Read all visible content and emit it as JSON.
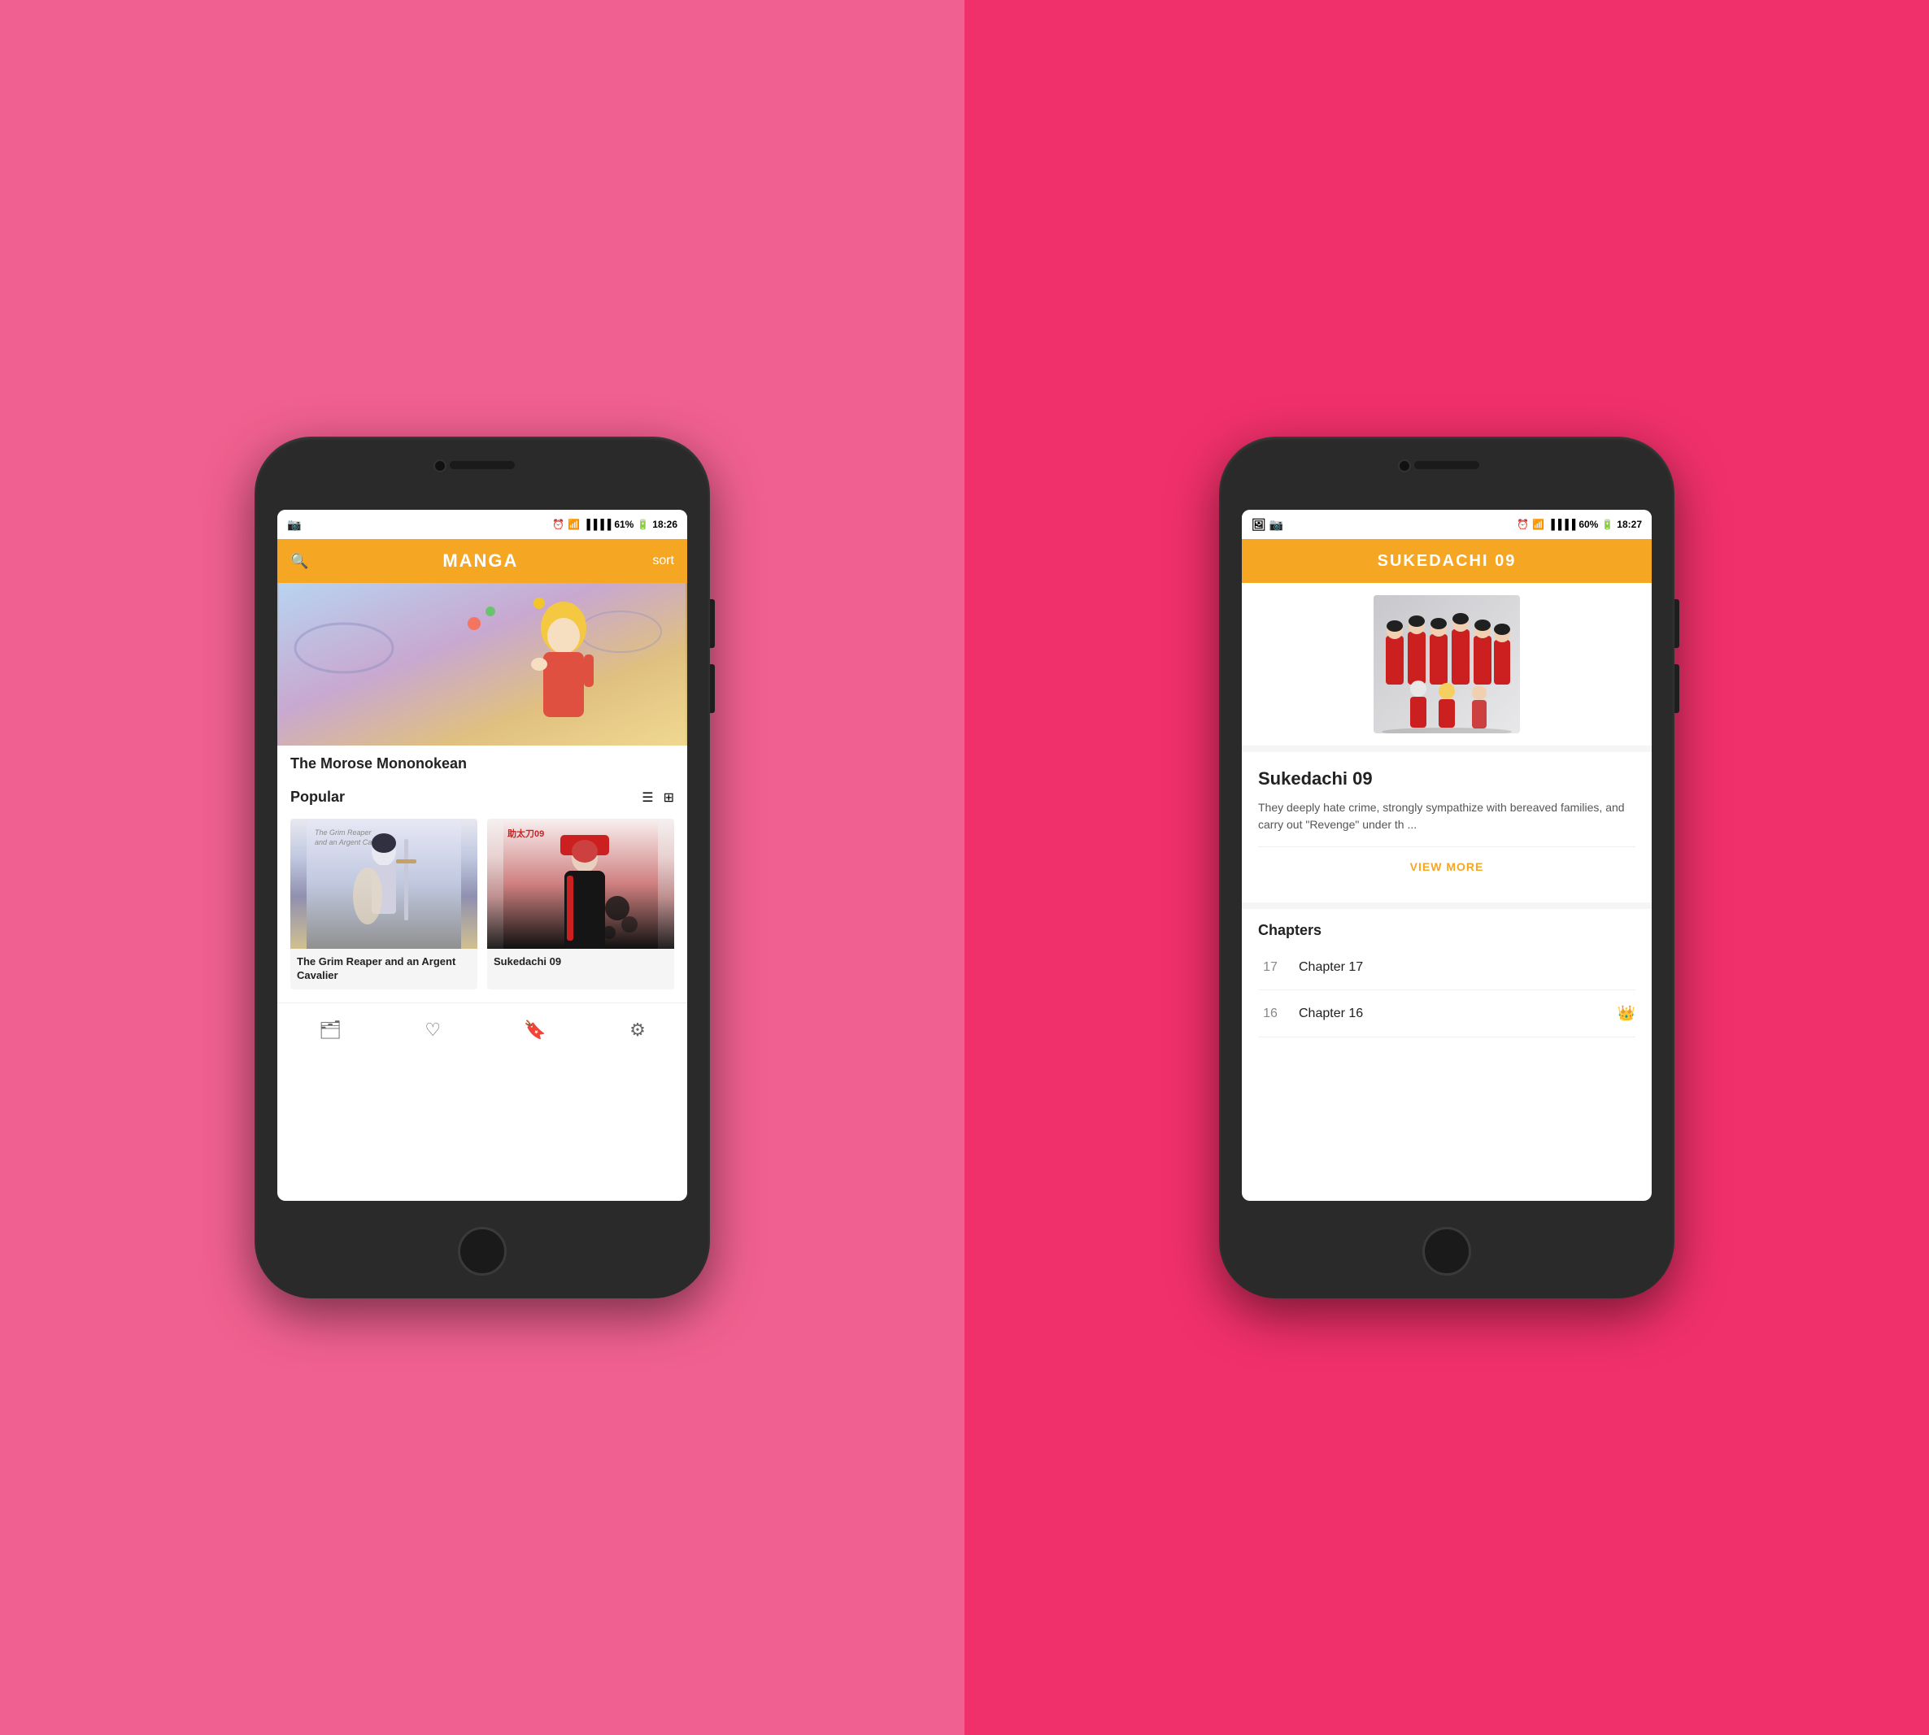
{
  "background": {
    "left_color": "#f06090",
    "right_color": "#f0306a"
  },
  "phone_left": {
    "status_bar": {
      "left_icons": [
        "camera-icon",
        "instagram-icon"
      ],
      "time": "18:26",
      "battery": "61%",
      "signal": "●●●●"
    },
    "header": {
      "title": "MANGA",
      "sort_label": "sort",
      "search_icon": "🔍"
    },
    "featured": {
      "title": "The Morose Mononokean"
    },
    "popular_section": {
      "label": "Popular"
    },
    "manga_cards": [
      {
        "title": "The Grim Reaper and an Argent Cavalier",
        "cover_type": "grim-reaper"
      },
      {
        "title": "Sukedachi 09",
        "cover_type": "sukedachi"
      }
    ],
    "bottom_nav": [
      {
        "icon": "🗂",
        "label": "library"
      },
      {
        "icon": "♡",
        "label": "favorites"
      },
      {
        "icon": "🔖",
        "label": "bookmarks"
      },
      {
        "icon": "⚙",
        "label": "settings"
      }
    ]
  },
  "phone_right": {
    "status_bar": {
      "left_icons": [
        "gallery-icon",
        "instagram-icon"
      ],
      "time": "18:27",
      "battery": "60%"
    },
    "header": {
      "title": "SUKEDACHI 09"
    },
    "detail": {
      "manga_title": "Sukedachi 09",
      "description": "They deeply hate crime, strongly sympathize with bereaved families, and carry out \"Revenge\" under th ...",
      "view_more_label": "VIEW MORE",
      "chapters_label": "Chapters",
      "chapters": [
        {
          "number": "17",
          "name": "Chapter 17",
          "has_crown": false
        },
        {
          "number": "16",
          "name": "Chapter 16",
          "has_crown": true
        }
      ]
    }
  }
}
